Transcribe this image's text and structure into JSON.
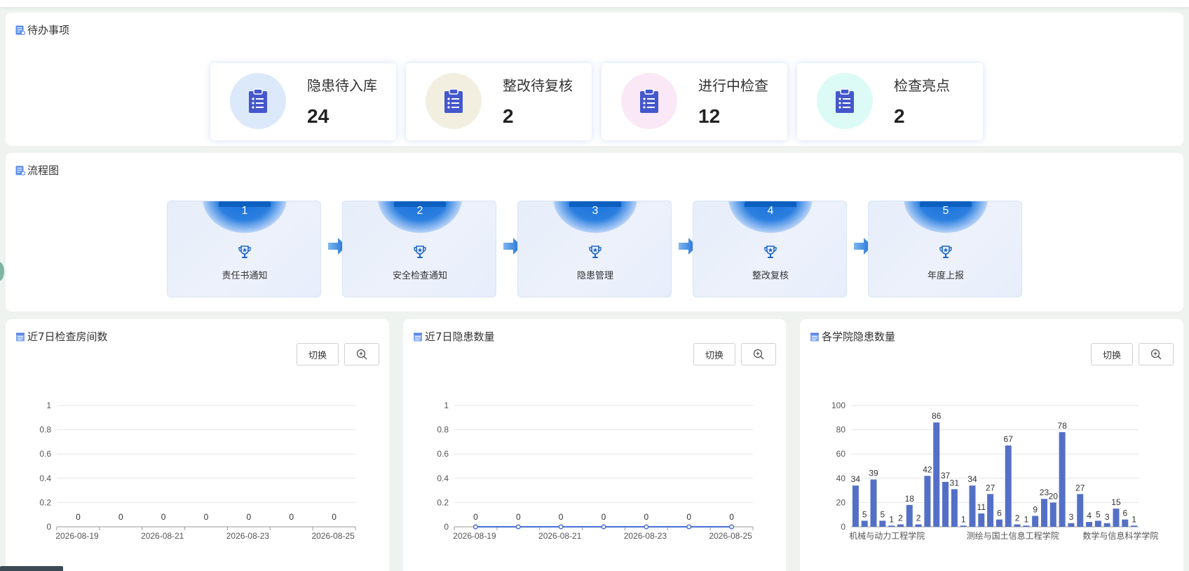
{
  "todo": {
    "title": "待办事项",
    "cards": [
      {
        "label": "隐患待入库",
        "count": "24",
        "color": "#dce9fb"
      },
      {
        "label": "整改待复核",
        "count": "2",
        "color": "#f2efe1"
      },
      {
        "label": "进行中检查",
        "count": "12",
        "color": "#fbe8f6"
      },
      {
        "label": "检查亮点",
        "count": "2",
        "color": "#dcfbf6"
      }
    ],
    "icon": "clipboard-icon",
    "icon_color": "#4457cc"
  },
  "flow": {
    "title": "流程图",
    "steps": [
      {
        "num": "1",
        "label": "责任书通知"
      },
      {
        "num": "2",
        "label": "安全检查通知"
      },
      {
        "num": "3",
        "label": "隐患管理"
      },
      {
        "num": "4",
        "label": "整改复核"
      },
      {
        "num": "5",
        "label": "年度上报"
      }
    ],
    "step_icon": "trophy-icon",
    "arrow_icon": "arrow-right-icon"
  },
  "panels": [
    {
      "title": "近7日检查房间数",
      "switch_label": "切换"
    },
    {
      "title": "近7日隐患数量",
      "switch_label": "切换"
    },
    {
      "title": "各学院隐患数量",
      "switch_label": "切换"
    }
  ],
  "chart_data": [
    {
      "type": "bar",
      "x": [
        "2026-08-19",
        "2026-08-20",
        "2026-08-21",
        "2026-08-22",
        "2026-08-23",
        "2026-08-24",
        "2026-08-25"
      ],
      "x_tick_labels": [
        "2026-08-19",
        "2026-08-21",
        "2026-08-23",
        "2026-08-25"
      ],
      "values": [
        0,
        0,
        0,
        0,
        0,
        0,
        0
      ],
      "ylim": [
        0,
        1
      ],
      "yticks": [
        "0",
        "0.2",
        "0.4",
        "0.6",
        "0.8",
        "1"
      ],
      "grid": true
    },
    {
      "type": "line",
      "x": [
        "2026-08-19",
        "2026-08-20",
        "2026-08-21",
        "2026-08-22",
        "2026-08-23",
        "2026-08-24",
        "2026-08-25"
      ],
      "x_tick_labels": [
        "2026-08-19",
        "2026-08-21",
        "2026-08-23",
        "2026-08-25"
      ],
      "values": [
        0,
        0,
        0,
        0,
        0,
        0,
        0
      ],
      "ylim": [
        0,
        1
      ],
      "yticks": [
        "0",
        "0.2",
        "0.4",
        "0.6",
        "0.8",
        "1"
      ],
      "grid": true,
      "color": "#4a6fd6"
    },
    {
      "type": "bar",
      "values": [
        34,
        5,
        39,
        5,
        1,
        2,
        18,
        2,
        42,
        86,
        37,
        31,
        1,
        34,
        11,
        27,
        6,
        67,
        2,
        1,
        9,
        23,
        20,
        78,
        3,
        27,
        4,
        5,
        3,
        15,
        6,
        1
      ],
      "x_tick_labels": [
        "机械与动力工程学院",
        "测绘与国土信息工程学院",
        "数学与信息科学学院"
      ],
      "ylim": [
        0,
        100
      ],
      "yticks": [
        "0",
        "20",
        "40",
        "60",
        "80",
        "100"
      ],
      "grid": true,
      "color": "#5470c6"
    }
  ]
}
